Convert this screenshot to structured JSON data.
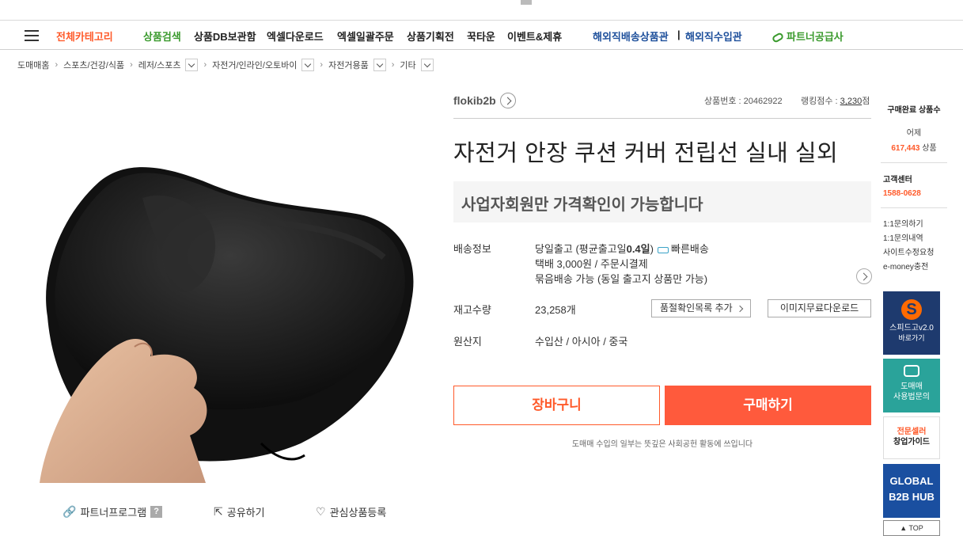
{
  "gnb": {
    "category_all": "전체카테고리",
    "menu": [
      "상품검색",
      "상품DB보관함",
      "엑셀다운로드",
      "엑셀일괄주문",
      "상품기획전",
      "꾹타운",
      "이벤트&제휴"
    ],
    "overseas": [
      "해외직배송상품관",
      "해외직수입관"
    ],
    "divider": "|",
    "partner": "파트너공급사"
  },
  "breadcrumb": [
    "도매매홈",
    "스포츠/건강/식품",
    "레저/스포츠",
    "자전거/인라인/오토바이",
    "자전거용품",
    "기타"
  ],
  "seller": {
    "name": "flokib2b"
  },
  "product": {
    "number_label": "상품번호 : ",
    "number": "20462922",
    "rank_label": "랭킹점수 : ",
    "rank": "3,230",
    "rank_unit": "점",
    "title": "자전거 안장 쿠션 커버 전립선 실내 실외",
    "price_notice": "사업자회원만 가격확인이 가능합니다"
  },
  "shipping": {
    "label": "배송정보",
    "line1_pre": "당일출고 (평균출고일",
    "line1_days": "0.4일",
    "line1_post": ")",
    "fast": "빠른배송",
    "line2": "택배 3,000원 / 주문시결제",
    "line3": "묶음배송 가능 (동일 출고지 상품만 가능)"
  },
  "stock": {
    "label": "재고수량",
    "value": "23,258개",
    "btn_soldout": "품절확인목록 추가",
    "btn_image": "이미지무료다운로드"
  },
  "origin": {
    "label": "원산지",
    "value": "수입산 / 아시아 / 중국"
  },
  "actions": {
    "cart": "장바구니",
    "buy": "구매하기"
  },
  "notice": "도매매 수입의 일부는 뜻깊은 사회공헌 활동에 쓰입니다",
  "tools": {
    "partner": "파트너프로그램",
    "partner_q": "?",
    "share": "공유하기",
    "wish": "관심상품등록"
  },
  "sidebar": {
    "title": "구매완료 상품수",
    "yesterday": "어제",
    "count": "617,443",
    "count_unit": "상품",
    "cs_title": "고객센터",
    "phone": "1588-0628",
    "links": [
      "1:1문의하기",
      "1:1문의내역",
      "사이트수정요청",
      "e-money충전"
    ],
    "banner1": [
      "스피드고v2.0",
      "바로가기"
    ],
    "banner2": [
      "도매매",
      "사용법문의"
    ],
    "banner3": [
      "전문셀러",
      "창업가이드"
    ],
    "banner4": [
      "GLOBAL",
      "B2B HUB"
    ],
    "top": "▲ TOP"
  },
  "colors": {
    "accent": "#ff5a2a",
    "green": "#3a9a2d",
    "navy": "#1d4f9b"
  }
}
